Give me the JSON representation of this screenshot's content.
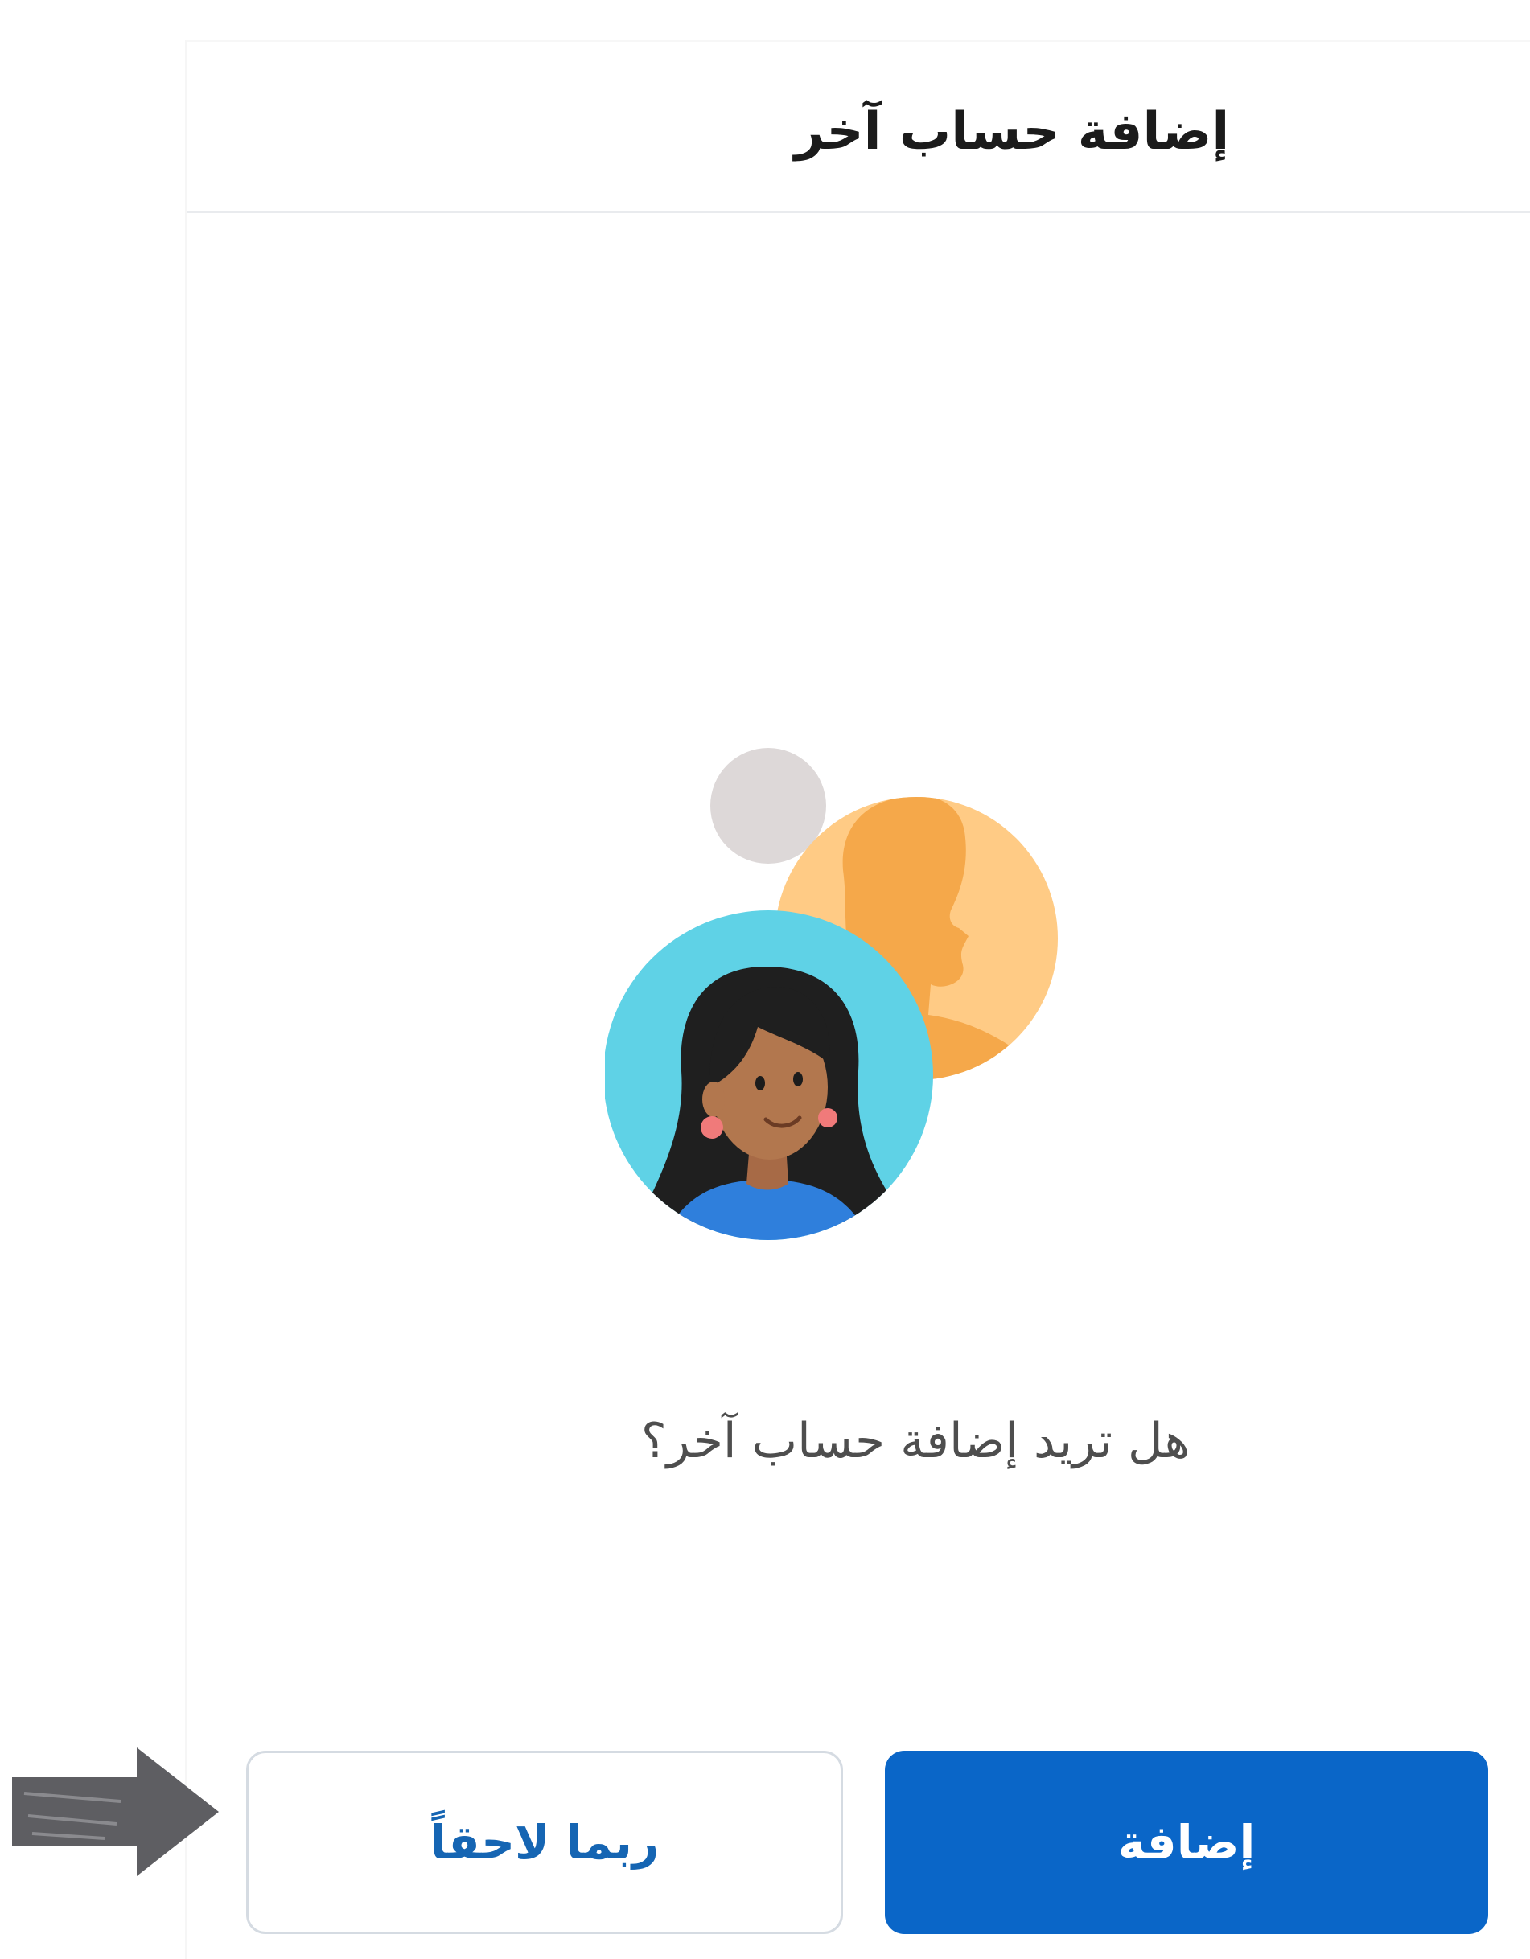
{
  "dialog": {
    "title": "إضافة حساب آخر",
    "question": "هل تريد إضافة حساب آخر؟"
  },
  "buttons": {
    "later_label": "ربما لاحقاً",
    "add_label": "إضافة"
  },
  "colors": {
    "primary": "#0a66c8",
    "secondary_text": "#1565b3",
    "arrow": "#5e5e62",
    "avatar_bg_cyan": "#5fd2e6",
    "avatar_bg_orange": "#ffcb85",
    "placeholder_gray": "#ddd8d8"
  },
  "icons": {
    "illustration": "add-account-avatars-illustration",
    "pointer": "pointing-arrow-icon"
  }
}
